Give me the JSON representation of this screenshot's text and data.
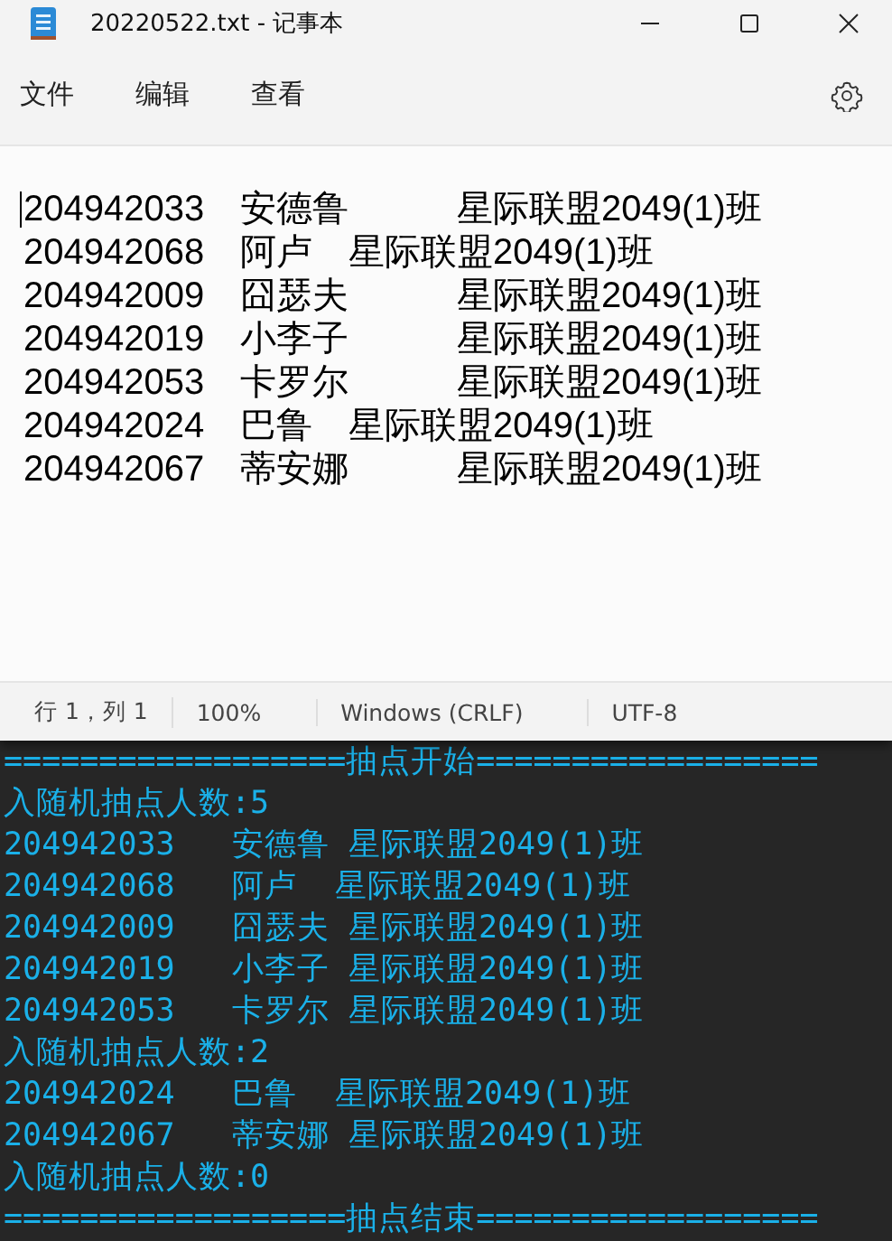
{
  "window": {
    "title": "20220522.txt - 记事本"
  },
  "menu": [
    "文件",
    "编辑",
    "查看"
  ],
  "editor": {
    "lines": [
      "204942033\t安德鲁\t星际联盟2049(1)班",
      "204942068\t阿卢\t星际联盟2049(1)班",
      "204942009\t囧瑟夫\t星际联盟2049(1)班",
      "204942019\t小李子\t星际联盟2049(1)班",
      "204942053\t卡罗尔\t星际联盟2049(1)班",
      "204942024\t巴鲁\t星际联盟2049(1)班",
      "204942067\t蒂安娜\t星际联盟2049(1)班"
    ]
  },
  "status_bar": [
    "行 1，列 1",
    "100%",
    "Windows (CRLF)",
    "UTF-8"
  ],
  "console": {
    "lines": [
      "==================抽点开始==================",
      "入随机抽点人数:5",
      "204942033   安德鲁 星际联盟2049(1)班",
      "204942068   阿卢  星际联盟2049(1)班",
      "204942009   囧瑟夫 星际联盟2049(1)班",
      "204942019   小李子 星际联盟2049(1)班",
      "204942053   卡罗尔 星际联盟2049(1)班",
      "入随机抽点人数:2",
      "204942024   巴鲁  星际联盟2049(1)班",
      "204942067   蒂安娜 星际联盟2049(1)班",
      "入随机抽点人数:0",
      "==================抽点结束=================="
    ]
  }
}
